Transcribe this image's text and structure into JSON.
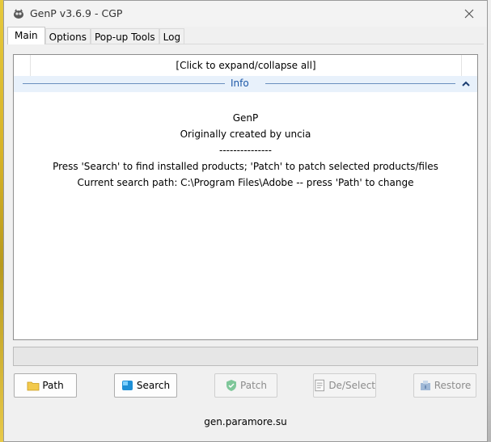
{
  "window": {
    "title": "GenP v3.6.9 - CGP"
  },
  "tabs": [
    {
      "label": "Main"
    },
    {
      "label": "Options"
    },
    {
      "label": "Pop-up Tools"
    },
    {
      "label": "Log"
    }
  ],
  "tree": {
    "expand_label": "[Click to expand/collapse all]",
    "section_label": "Info"
  },
  "info": {
    "line1": "GenP",
    "line2": "Originally created by uncia",
    "line3": "---------------",
    "line4": "Press 'Search' to find installed products; 'Patch' to patch selected products/files",
    "line5": "Current search path: C:\\Program Files\\Adobe -- press 'Path' to change"
  },
  "buttons": {
    "path": "Path",
    "search": "Search",
    "patch": "Patch",
    "deselect": "De/Select",
    "restore": "Restore"
  },
  "footer": {
    "url": "gen.paramore.su"
  },
  "colors": {
    "accent": "#1c58a8",
    "info_bg": "#e8f1fb"
  }
}
